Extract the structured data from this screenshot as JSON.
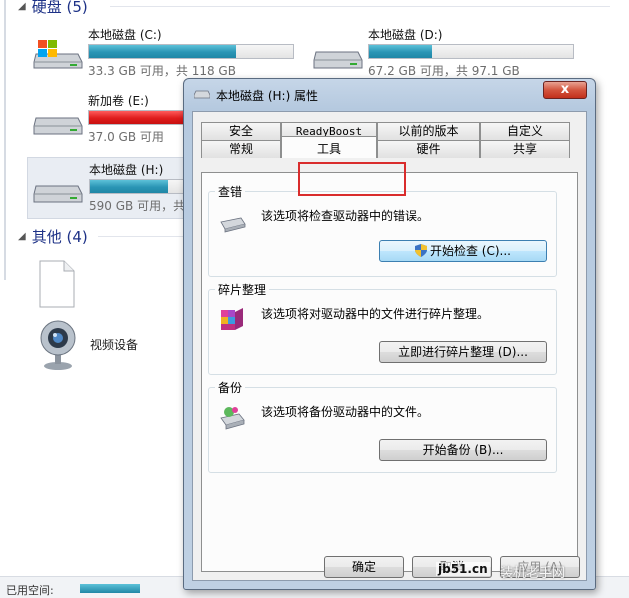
{
  "explorer": {
    "hard_disk_group": {
      "label": "硬盘 (5)"
    },
    "other_group": {
      "label": "其他 (4)"
    },
    "drives": [
      {
        "name": "本地磁盘 (C:)",
        "size_text": "33.3 GB 可用，共 118 GB",
        "used_fraction": 0.72,
        "bar_color": "blue"
      },
      {
        "name": "本地磁盘 (D:)",
        "size_text": "67.2 GB 可用，共 97.1 GB",
        "used_fraction": 0.31,
        "bar_color": "blue"
      },
      {
        "name": "新加卷 (E:)",
        "size_text": "37.0 GB 可用",
        "used_fraction": 0.95,
        "bar_color": "red"
      },
      {
        "name": "本地磁盘 (H:)",
        "size_text": "590 GB 可用，共",
        "used_fraction": 0.38,
        "bar_color": "blue"
      }
    ],
    "devices": [
      {
        "name": "视频设备",
        "icon": "webcam-icon"
      }
    ],
    "status_bar": {
      "label": "已用空间:"
    }
  },
  "dialog": {
    "title": "本地磁盘 (H:) 属性",
    "close_label": "x",
    "tabs_row_back": [
      "安全",
      "ReadyBoost",
      "以前的版本",
      "自定义"
    ],
    "tabs_row_front": [
      "常规",
      "工具",
      "硬件",
      "共享"
    ],
    "active_tab": "工具",
    "groups": [
      {
        "title": "查错",
        "text": "该选项将检查驱动器中的错误。",
        "button": "开始检查 (C)...",
        "icon": "drive-check-icon"
      },
      {
        "title": "碎片整理",
        "text": "该选项将对驱动器中的文件进行碎片整理。",
        "button": "立即进行碎片整理 (D)...",
        "icon": "defrag-icon"
      },
      {
        "title": "备份",
        "text": "该选项将备份驱动器中的文件。",
        "button": "开始备份 (B)...",
        "icon": "backup-icon"
      }
    ],
    "footer": {
      "ok": "确定",
      "cancel": "取消",
      "apply": "应用 (A)"
    }
  },
  "watermark": {
    "site": "jb51.cn",
    "text": "装机老手网"
  },
  "colors": {
    "accent": "#2a95b5",
    "highlight_box": "#d92c2c",
    "full_drive": "#df1c1c"
  }
}
